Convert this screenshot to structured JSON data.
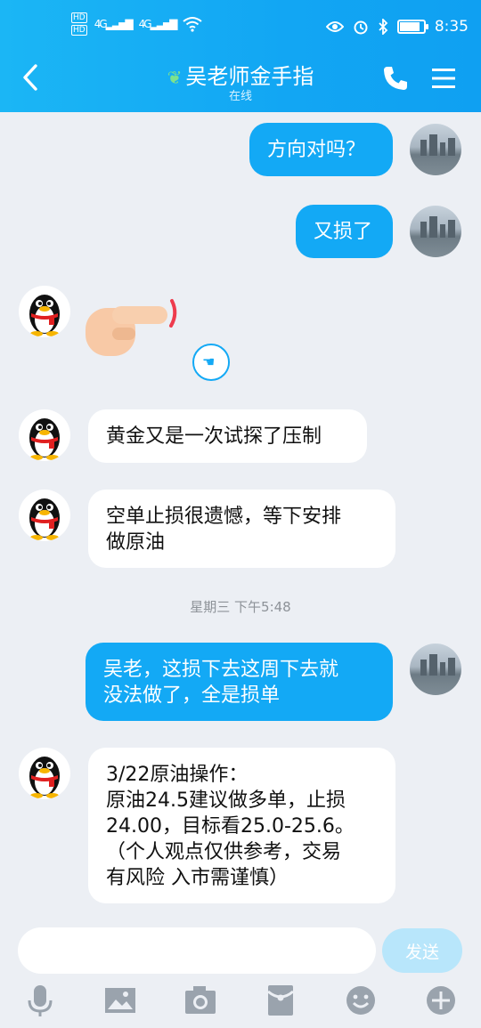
{
  "status_bar": {
    "hd1": "HD",
    "hd2": "HD",
    "net1": "4G",
    "net2": "4G",
    "time": "8:35",
    "battery_level": 0.9
  },
  "header": {
    "title": "吴老师金手指",
    "subtitle": "在线"
  },
  "messages": [
    {
      "sender": "me",
      "text": "方向对吗？"
    },
    {
      "sender": "me",
      "text": "又损了"
    },
    {
      "sender": "other",
      "type": "sticker",
      "sticker": "pointing-finger"
    },
    {
      "sender": "other",
      "text": "黄金又是一次试探了压制"
    },
    {
      "sender": "other",
      "text": "空单止损很遗憾，等下安排\n做原油"
    },
    {
      "sender": "me",
      "text": "吴老，这损下去这周下去就\n没法做了，全是损单"
    },
    {
      "sender": "other",
      "text": "3/22原油操作：\n原油24.5建议做多单，止损\n24.00，目标看25.0-25.6。\n（个人观点仅供参考，交易\n有风险 入市需谨慎）"
    }
  ],
  "timestamp": "星期三 下午5:48",
  "input": {
    "placeholder": "",
    "value": "",
    "send_label": "发送"
  },
  "toolbar": [
    "mic-icon",
    "image-icon",
    "camera-icon",
    "red-packet-icon",
    "emoji-icon",
    "plus-icon"
  ],
  "colors": {
    "header": "#12a6f3",
    "my_bubble": "#13a9f5",
    "background": "#eceff4"
  }
}
